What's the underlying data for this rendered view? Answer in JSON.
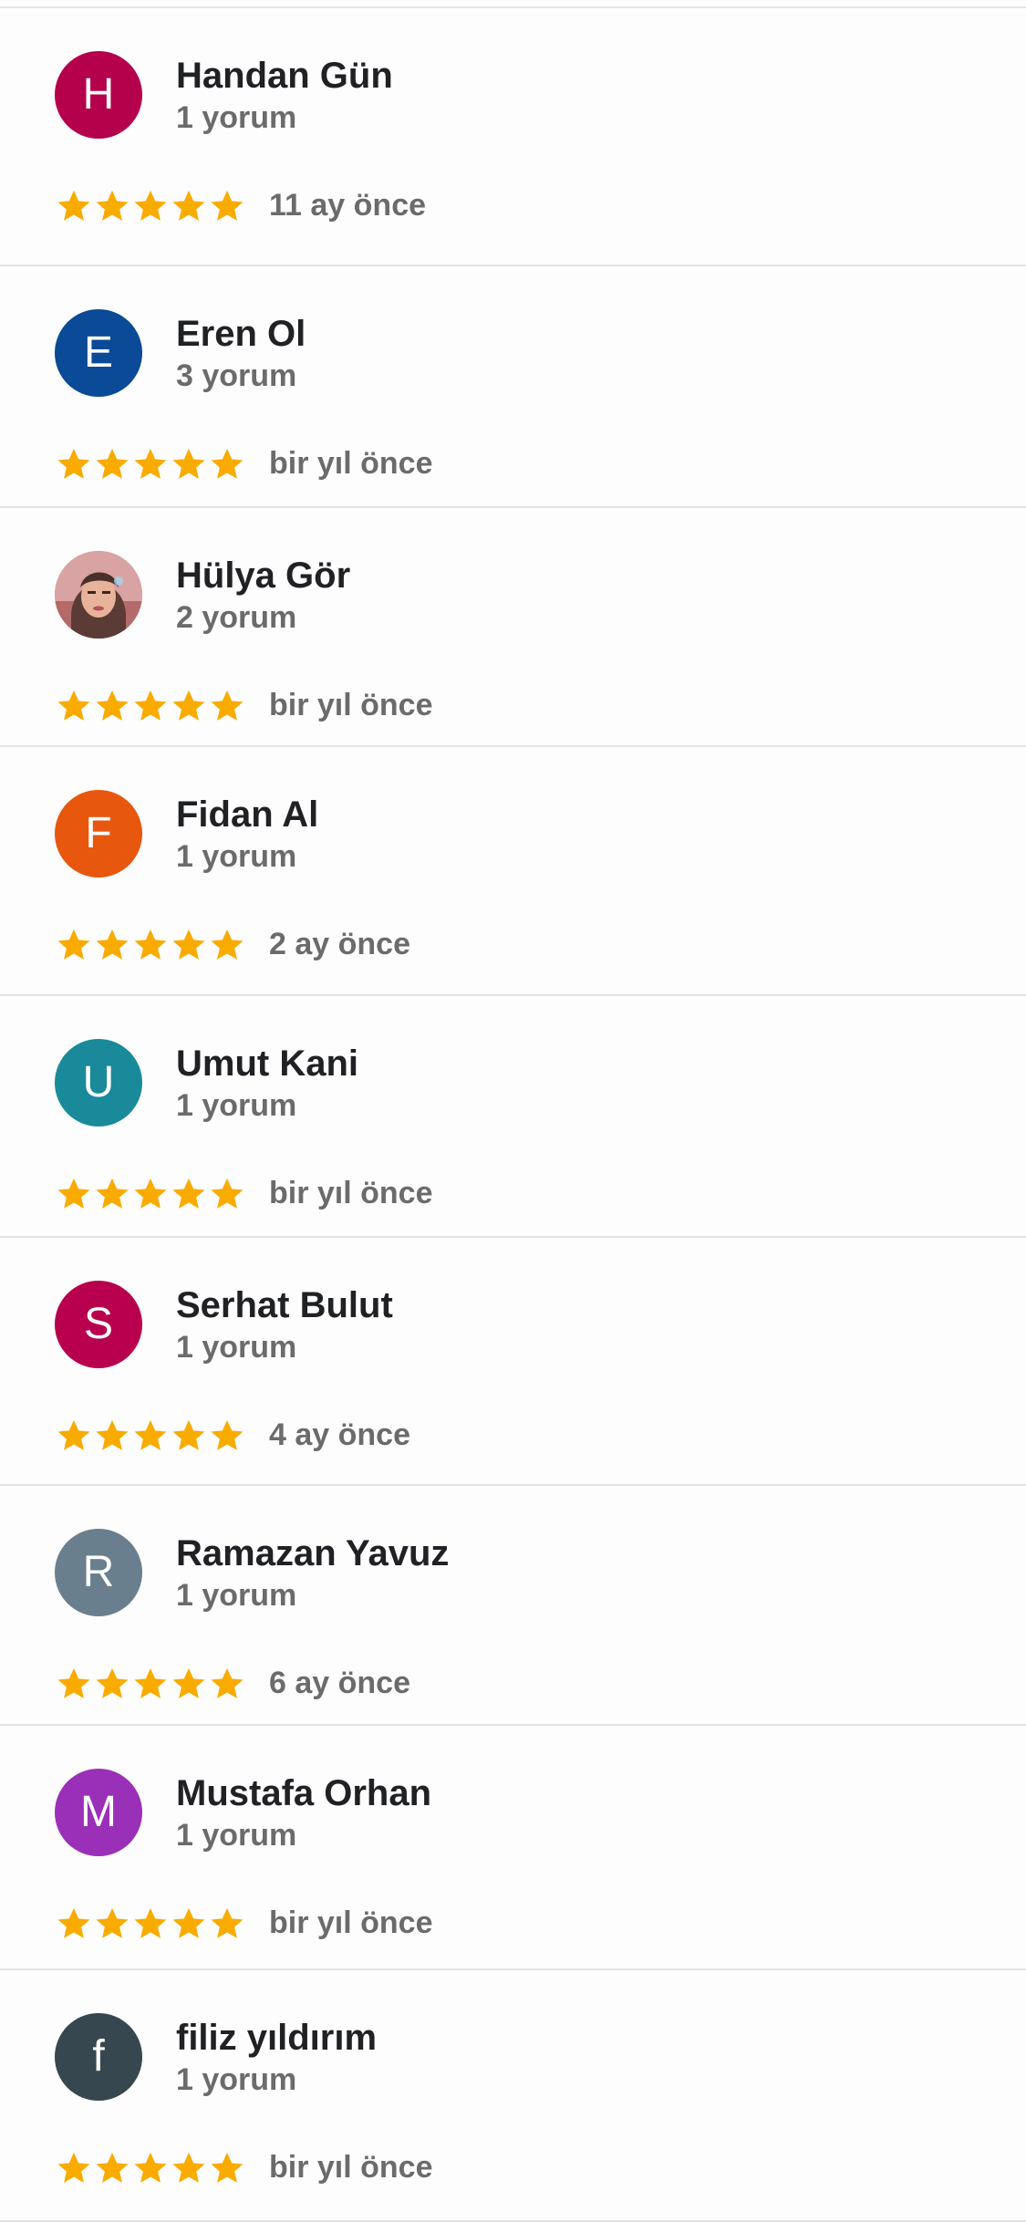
{
  "star_color": "#f9ab00",
  "reviews": [
    {
      "name": "Handan Gün",
      "count": "1 yorum",
      "initial": "H",
      "avatar_color": "#b5004c",
      "rating": 5,
      "time": "11 ay önce"
    },
    {
      "name": "Eren Ol",
      "count": "3 yorum",
      "initial": "E",
      "avatar_color": "#0a4a96",
      "rating": 5,
      "time": "bir yıl önce"
    },
    {
      "name": "Hülya Gör",
      "count": "2 yorum",
      "initial": "",
      "avatar_color": "#c98a8a",
      "avatar_photo": true,
      "rating": 5,
      "time": "bir yıl önce"
    },
    {
      "name": "Fidan Al",
      "count": "1 yorum",
      "initial": "F",
      "avatar_color": "#e8570e",
      "rating": 5,
      "time": "2 ay önce"
    },
    {
      "name": "Umut Kani",
      "count": "1 yorum",
      "initial": "U",
      "avatar_color": "#1a8a9a",
      "rating": 5,
      "time": "bir yıl önce"
    },
    {
      "name": "Serhat Bulut",
      "count": "1 yorum",
      "initial": "S",
      "avatar_color": "#b8004e",
      "rating": 5,
      "time": "4 ay önce"
    },
    {
      "name": "Ramazan Yavuz",
      "count": "1 yorum",
      "initial": "R",
      "avatar_color": "#6a7f8e",
      "rating": 5,
      "time": "6 ay önce"
    },
    {
      "name": "Mustafa Orhan",
      "count": "1 yorum",
      "initial": "M",
      "avatar_color": "#9a2fb8",
      "rating": 5,
      "time": "bir yıl önce"
    },
    {
      "name": "filiz yıldırım",
      "count": "1 yorum",
      "initial": "f",
      "avatar_color": "#37474f",
      "rating": 5,
      "time": "bir yıl önce"
    }
  ]
}
